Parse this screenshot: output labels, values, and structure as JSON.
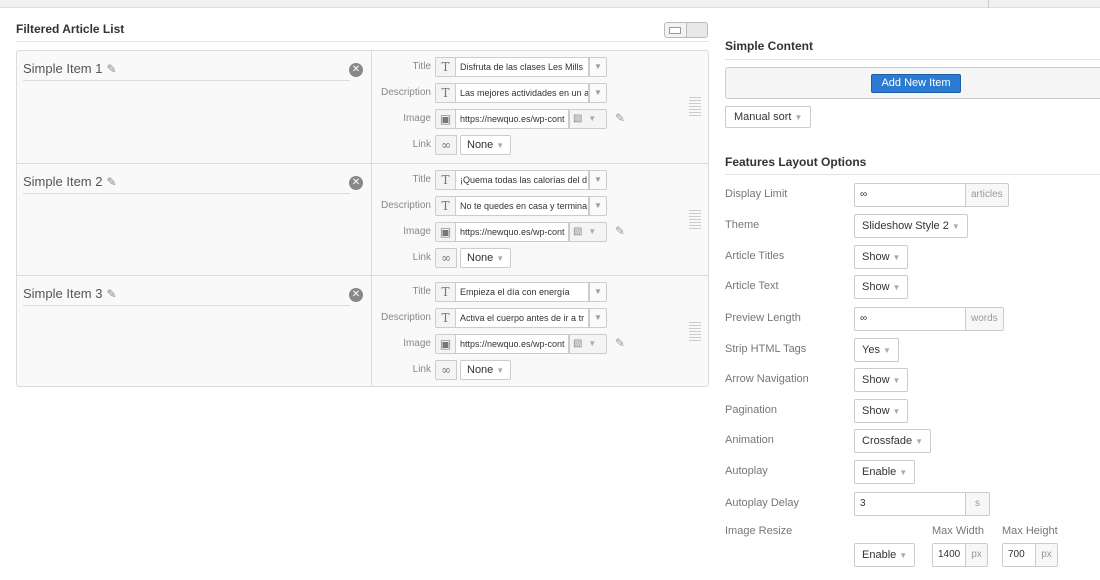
{
  "filtered_list": {
    "title": "Filtered Article List",
    "items": [
      {
        "name": "Simple Item 1",
        "title_label": "Title",
        "title_value": "Disfruta de las clases Les Mills",
        "desc_label": "Description",
        "desc_value": "Las mejores actividades en un a",
        "image_label": "Image",
        "image_value": "https://newquo.es/wp-cont",
        "link_label": "Link",
        "link_value": "None"
      },
      {
        "name": "Simple Item 2",
        "title_label": "Title",
        "title_value": "¡Quema todas las calorías del d",
        "desc_label": "Description",
        "desc_value": "No te quedes en casa y termina",
        "image_label": "Image",
        "image_value": "https://newquo.es/wp-cont",
        "link_label": "Link",
        "link_value": "None"
      },
      {
        "name": "Simple Item 3",
        "title_label": "Title",
        "title_value": "Empieza el día con energía",
        "desc_label": "Description",
        "desc_value": "Activa el cuerpo antes de ir a tr",
        "image_label": "Image",
        "image_value": "https://newquo.es/wp-cont",
        "link_label": "Link",
        "link_value": "None"
      }
    ]
  },
  "simple_content": {
    "title": "Simple Content",
    "add_button": "Add New Item",
    "sort_button": "Manual sort"
  },
  "features": {
    "title": "Features Layout Options",
    "display_limit": {
      "label": "Display Limit",
      "value": "∞",
      "unit": "articles"
    },
    "theme": {
      "label": "Theme",
      "value": "Slideshow Style 2"
    },
    "article_titles": {
      "label": "Article Titles",
      "value": "Show"
    },
    "article_text": {
      "label": "Article Text",
      "value": "Show"
    },
    "preview_length": {
      "label": "Preview Length",
      "value": "∞",
      "unit": "words"
    },
    "strip_html": {
      "label": "Strip HTML Tags",
      "value": "Yes"
    },
    "arrow_nav": {
      "label": "Arrow Navigation",
      "value": "Show"
    },
    "pagination": {
      "label": "Pagination",
      "value": "Show"
    },
    "animation": {
      "label": "Animation",
      "value": "Crossfade"
    },
    "autoplay": {
      "label": "Autoplay",
      "value": "Enable"
    },
    "autoplay_delay": {
      "label": "Autoplay Delay",
      "value": "3",
      "unit": "s"
    },
    "image_resize": {
      "label": "Image Resize",
      "value": "Enable",
      "max_width_label": "Max Width",
      "max_height_label": "Max Height",
      "max_width": "1400",
      "max_height": "700",
      "unit": "px"
    }
  }
}
